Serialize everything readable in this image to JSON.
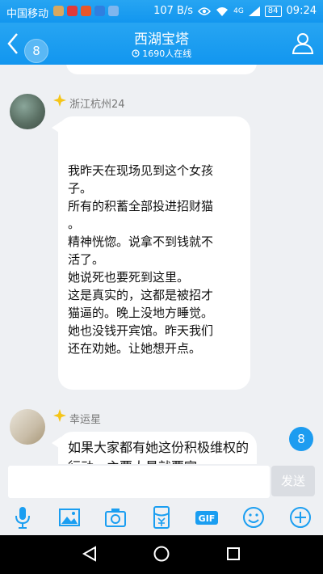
{
  "status_bar": {
    "carrier": "中国移动",
    "net_speed": "107 B/s",
    "signal_type": "4G",
    "battery": "84",
    "time": "09:24"
  },
  "header": {
    "back_badge": "8",
    "title": "西湖宝塔",
    "online": "1690人在线"
  },
  "messages": [
    {
      "sender": "浙江杭州24",
      "lines": [
        "我昨天在现场见到这个女孩",
        "子。",
        "所有的积蓄全部投进招财猫",
        "。",
        "精神恍惚。说拿不到钱就不",
        "活了。",
        "她说死也要死到这里。",
        "这是真实的，这都是被招才",
        "猫逼的。晚上没地方睡觉。",
        "她也没钱开宾馆。昨天我们",
        "还在劝她。让她想开点。"
      ]
    },
    {
      "sender": "幸运星",
      "text": "如果大家都有她这份积极维权的行动，主要大量就要官"
    }
  ],
  "new_message_badge": "8",
  "input": {
    "value": "",
    "send_label": "发送"
  },
  "colors": {
    "header_blue": "#1296ef",
    "badge_blue": "#1d9cf0"
  }
}
